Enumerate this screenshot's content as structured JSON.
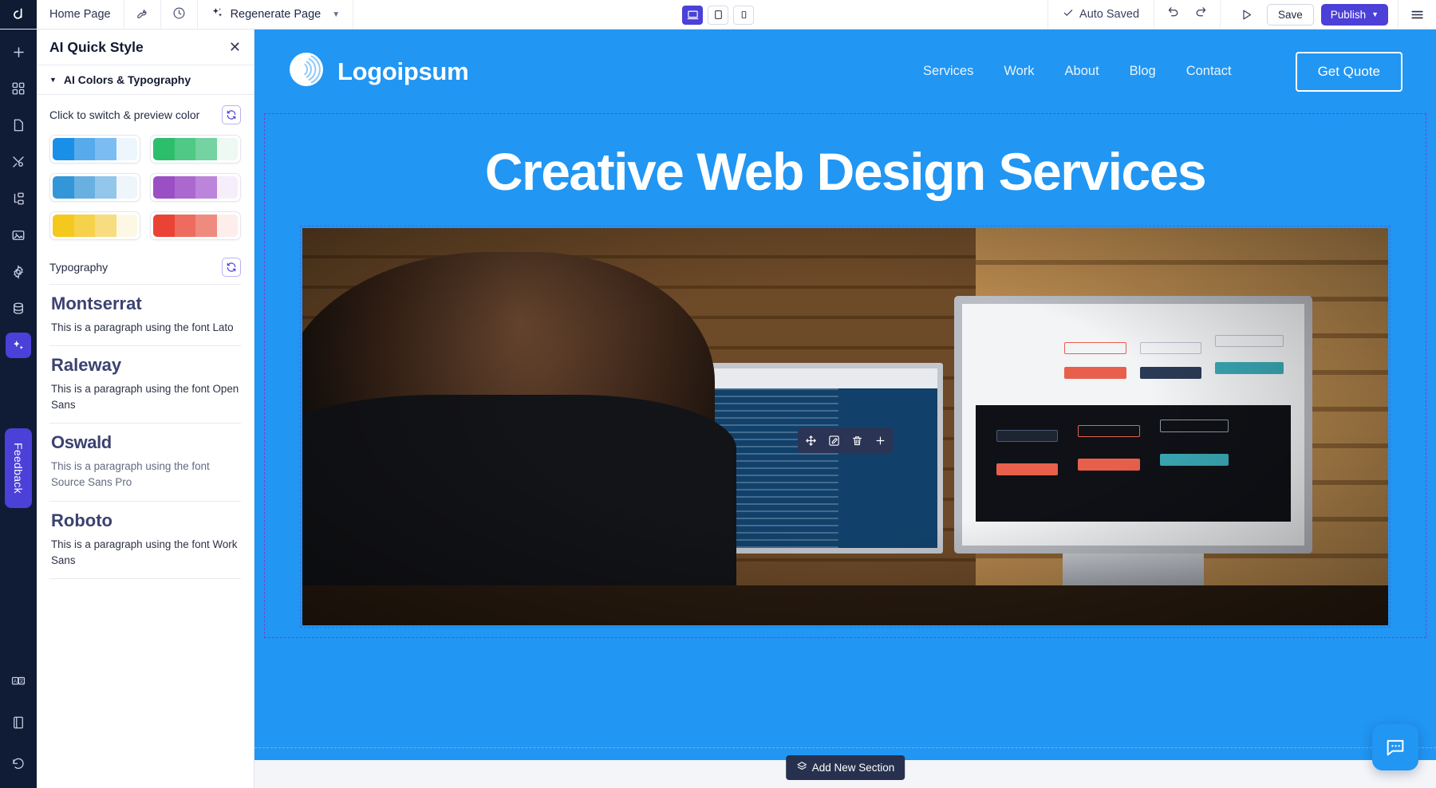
{
  "topbar": {
    "brand_icon": "dorik-logo-icon",
    "page_name": "Home Page",
    "wrench_icon": "wrench-icon",
    "history_icon": "clock-history-icon",
    "regenerate_label": "Regenerate Page",
    "regenerate_icon": "sparkles-icon",
    "regenerate_chevron": "chevron-down-icon",
    "devices": [
      {
        "name": "desktop-view-button",
        "icon": "desktop-icon",
        "active": true
      },
      {
        "name": "tablet-view-button",
        "icon": "tablet-icon",
        "active": false
      },
      {
        "name": "mobile-view-button",
        "icon": "mobile-icon",
        "active": false
      }
    ],
    "autosave_label": "Auto Saved",
    "autosave_icon": "check-icon",
    "undo_icon": "undo-icon",
    "redo_icon": "redo-icon",
    "preview_icon": "play-preview-icon",
    "save_label": "Save",
    "publish_label": "Publish",
    "publish_chevron": "chevron-down-icon",
    "menu_icon": "hamburger-menu-icon"
  },
  "rail": {
    "items": [
      {
        "name": "rail-add-icon",
        "icon": "plus-icon",
        "active": false
      },
      {
        "name": "rail-elements-icon",
        "icon": "grid-blocks-icon",
        "active": false
      },
      {
        "name": "rail-pages-icon",
        "icon": "page-icon",
        "active": false
      },
      {
        "name": "rail-style-icon",
        "icon": "brush-icon",
        "active": false
      },
      {
        "name": "rail-layers-icon",
        "icon": "layers-tree-icon",
        "active": false
      },
      {
        "name": "rail-media-icon",
        "icon": "image-icon",
        "active": false
      },
      {
        "name": "rail-settings-icon",
        "icon": "gear-icon",
        "active": false
      },
      {
        "name": "rail-database-icon",
        "icon": "database-icon",
        "active": false
      },
      {
        "name": "rail-ai-icon",
        "icon": "sparkles-icon",
        "active": true
      }
    ],
    "feedback_label": "Feedback",
    "bottom_items": [
      {
        "name": "rail-translate-icon",
        "icon": "translate-icon"
      },
      {
        "name": "rail-docs-icon",
        "icon": "book-icon"
      },
      {
        "name": "rail-history-icon",
        "icon": "revert-clock-icon"
      }
    ]
  },
  "panel": {
    "title": "AI Quick Style",
    "close_icon": "close-icon",
    "accordion_label": "AI Colors & Typography",
    "accordion_caret": "caret-down-icon",
    "colors_label": "Click to switch & preview color",
    "colors_refresh_icon": "refresh-icon",
    "palettes": [
      {
        "name": "palette-blue-vivid",
        "colors": [
          "#1a8fe8",
          "#57aaec",
          "#7bbdf2",
          "#eef6fd"
        ]
      },
      {
        "name": "palette-green",
        "colors": [
          "#2dbe6c",
          "#4fc985",
          "#74d3a0",
          "#edf9f2"
        ]
      },
      {
        "name": "palette-blue-muted",
        "colors": [
          "#3396d8",
          "#68b0e0",
          "#92c6ea",
          "#eef5fb"
        ]
      },
      {
        "name": "palette-purple",
        "colors": [
          "#9b4fc4",
          "#ab69cf",
          "#bc84da",
          "#f7eefb"
        ]
      },
      {
        "name": "palette-yellow",
        "colors": [
          "#f5c81e",
          "#f6d14a",
          "#f7dc80",
          "#fdf8e4"
        ]
      },
      {
        "name": "palette-red",
        "colors": [
          "#ea4335",
          "#ed6c5f",
          "#ef8a7f",
          "#fdeeec"
        ]
      }
    ],
    "typography_label": "Typography",
    "typography_refresh_icon": "refresh-icon",
    "fonts": [
      {
        "heading": "Montserrat",
        "paragraph": "This is a paragraph using the font Lato"
      },
      {
        "heading": "Raleway",
        "paragraph": "This is a paragraph using the font Open Sans"
      },
      {
        "heading": "Oswald",
        "paragraph": "This is a paragraph using the font Source Sans Pro"
      },
      {
        "heading": "Roboto",
        "paragraph": "This is a paragraph using the font Work Sans"
      }
    ]
  },
  "site": {
    "brand_name": "Logoipsum",
    "brand_logo_icon": "concentric-circles-logo-icon",
    "nav_links": [
      "Services",
      "Work",
      "About",
      "Blog",
      "Contact"
    ],
    "cta_label": "Get Quote",
    "hero_title": "Creative Web Design Services",
    "hero_image_alt": "man-at-desk-with-two-monitors-photo",
    "accent_color": "#2196f3"
  },
  "canvas": {
    "element_toolbar": [
      {
        "name": "move-element-button",
        "icon": "move-arrows-icon"
      },
      {
        "name": "edit-element-button",
        "icon": "pencil-square-icon"
      },
      {
        "name": "delete-element-button",
        "icon": "trash-icon"
      },
      {
        "name": "add-element-button",
        "icon": "plus-icon"
      }
    ],
    "add_section_label": "Add New Section",
    "add_section_icon": "layers-icon",
    "chat_icon": "chat-bubble-icon"
  }
}
